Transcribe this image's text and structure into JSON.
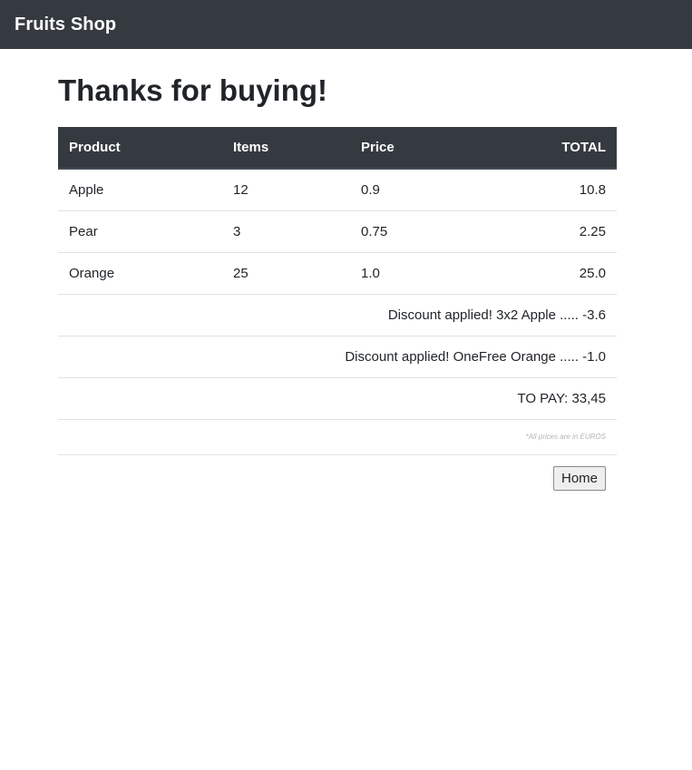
{
  "navbar": {
    "brand": "Fruits Shop"
  },
  "page": {
    "heading": "Thanks for buying!"
  },
  "table": {
    "headers": {
      "product": "Product",
      "items": "Items",
      "price": "Price",
      "total": "TOTAL"
    },
    "rows": [
      {
        "product": "Apple",
        "items": "12",
        "price": "0.9",
        "total": "10.8"
      },
      {
        "product": "Pear",
        "items": "3",
        "price": "0.75",
        "total": "2.25"
      },
      {
        "product": "Orange",
        "items": "25",
        "price": "1.0",
        "total": "25.0"
      }
    ],
    "discounts": [
      "Discount applied! 3x2 Apple ..... -3.6",
      "Discount applied! OneFree Orange ..... -1.0"
    ],
    "to_pay": "TO PAY: 33,45",
    "note": "*All prices are in EUROS"
  },
  "actions": {
    "home_label": "Home"
  },
  "colors": {
    "navbar_bg": "#343a40",
    "header_bg": "#343a40",
    "row_divider": "#dee2e6"
  }
}
